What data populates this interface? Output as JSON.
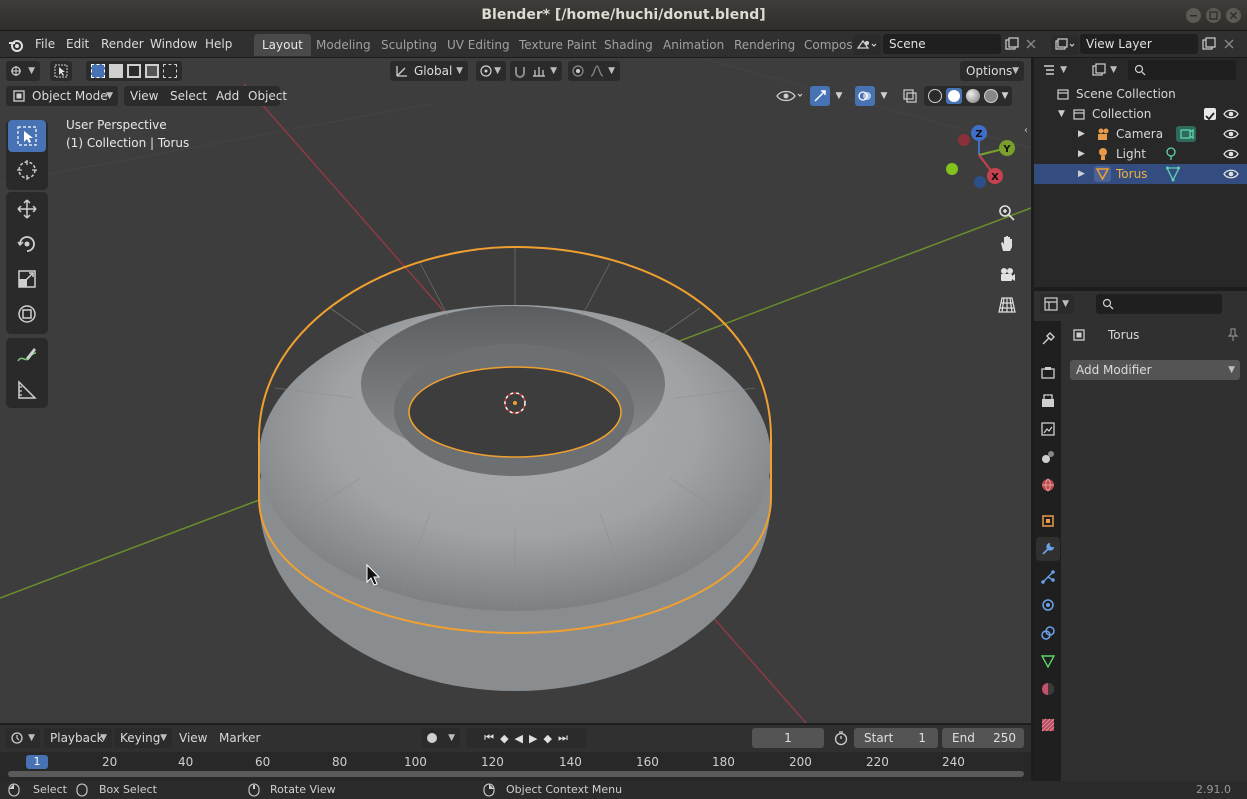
{
  "window": {
    "title": "Blender* [/home/huchi/donut.blend]"
  },
  "menus": [
    "File",
    "Edit",
    "Render",
    "Window",
    "Help"
  ],
  "workspaces": [
    "Layout",
    "Modeling",
    "Sculpting",
    "UV Editing",
    "Texture Paint",
    "Shading",
    "Animation",
    "Rendering",
    "Compos"
  ],
  "active_workspace": "Layout",
  "scene": {
    "name": "Scene"
  },
  "view_layer": {
    "name": "View Layer"
  },
  "tool_header": {
    "orientation": "Global",
    "options_label": "Options"
  },
  "viewport_header": {
    "mode": "Object Mode",
    "menus": [
      "View",
      "Select",
      "Add",
      "Object"
    ]
  },
  "viewport_overlay": {
    "line1": "User Perspective",
    "line2": "(1) Collection | Torus"
  },
  "gizmo": {
    "z": "Z",
    "y": "Y",
    "x": "X"
  },
  "outliner": {
    "root": "Scene Collection",
    "collection": "Collection",
    "items": [
      {
        "name": "Camera",
        "selected": false
      },
      {
        "name": "Light",
        "selected": false
      },
      {
        "name": "Torus",
        "selected": true
      }
    ]
  },
  "properties": {
    "object_name": "Torus",
    "add_modifier": "Add Modifier"
  },
  "timeline": {
    "menus": [
      "Playback",
      "Keying",
      "View",
      "Marker"
    ],
    "current_frame": "1",
    "start_label": "Start",
    "start": "1",
    "end_label": "End",
    "end": "250",
    "ruler": [
      "1",
      "20",
      "40",
      "60",
      "80",
      "100",
      "120",
      "140",
      "160",
      "180",
      "200",
      "220",
      "240"
    ]
  },
  "statusbar": {
    "select": "Select",
    "box_select": "Box Select",
    "rotate_view": "Rotate View",
    "context_menu": "Object Context Menu",
    "version": "2.91.0"
  },
  "colors": {
    "accent": "#4772b3",
    "selection_outline": "#f0a030",
    "x_axis": "#b33a4a",
    "y_axis": "#7aa02c"
  }
}
